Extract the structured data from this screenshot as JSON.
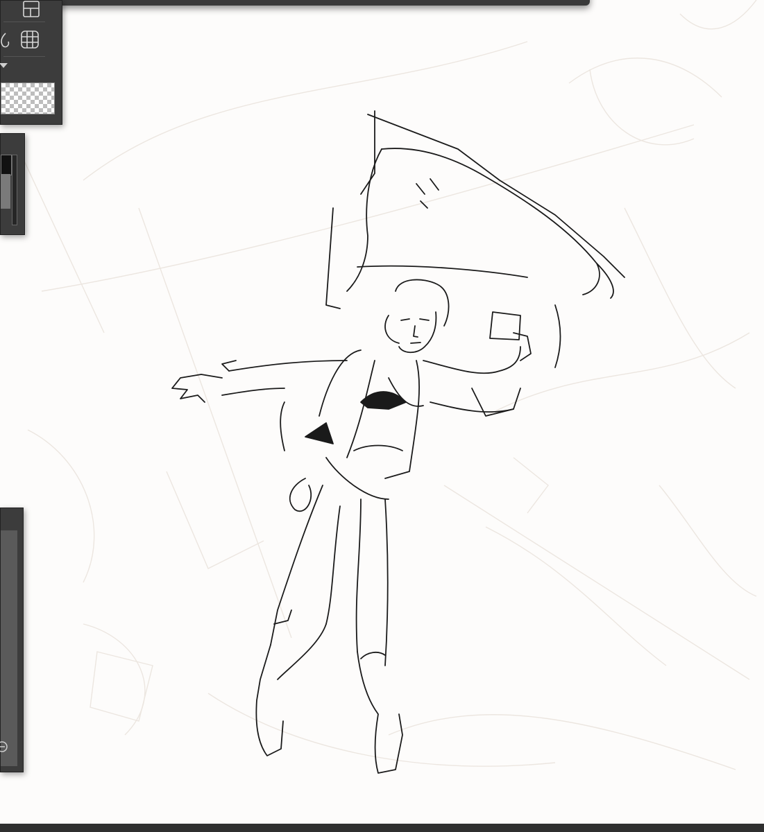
{
  "app": {
    "name": "",
    "accent": "#3c3c3c"
  },
  "tools": [
    {
      "name": "frame-tool-icon"
    },
    {
      "name": "fill-tool-icon"
    },
    {
      "name": "mesh-transform-icon"
    }
  ],
  "layer_preview": {
    "name": "transparent-layer-thumbnail"
  },
  "color": {
    "main": "#111111",
    "sub": "#7a7a7a"
  },
  "canvas": {
    "background": "#fdfcfb",
    "lineart_color": "#1a1a1a",
    "sketch_color": "#e8e2dc"
  }
}
